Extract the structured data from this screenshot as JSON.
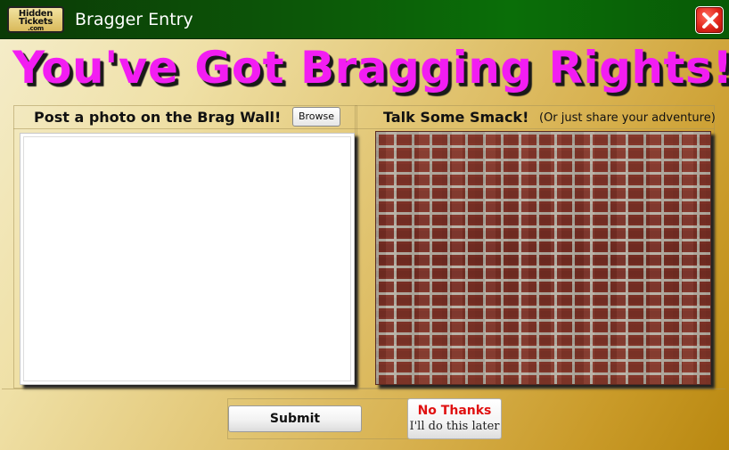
{
  "window": {
    "title": "Bragger Entry",
    "logo_lines": [
      "Hidden",
      "Tickets",
      ".com"
    ]
  },
  "headline": "You've Got Bragging Rights!",
  "photo_section": {
    "title": "Post a photo on the Brag Wall!",
    "browse_label": "Browse"
  },
  "smack_section": {
    "title": "Talk Some Smack!",
    "subtitle": "(Or just share your adventure)"
  },
  "buttons": {
    "submit_label": "Submit",
    "no_thanks_label": "No Thanks",
    "no_thanks_sub": "I'll do this later"
  },
  "colors": {
    "headline": "#f21df2",
    "titlebar": "#0c5a08",
    "close": "#e0241a",
    "no_thanks_text": "#e01010"
  },
  "icons": {
    "close": "close-icon",
    "logo": "hidden-tickets-logo"
  }
}
